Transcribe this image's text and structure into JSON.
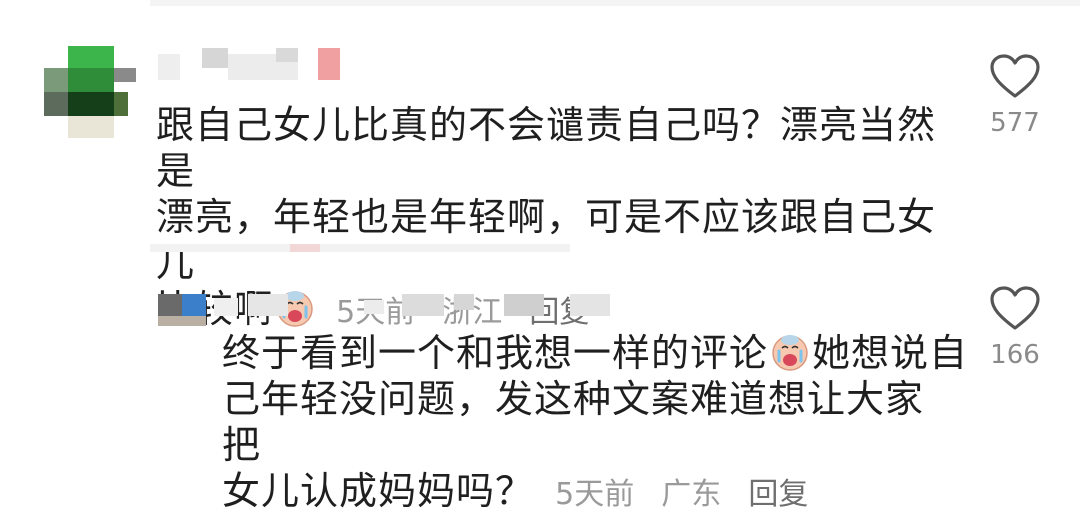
{
  "comments": [
    {
      "text_line1": "跟自己女儿比真的不会谴责自己吗？漂亮当然是",
      "text_line2": "漂亮，年轻也是年轻啊，可是不应该跟自己女儿",
      "text_line3": "比较啊",
      "emoji": "crying-face-icon",
      "time": "5天前",
      "location": "浙江",
      "reply": "回复",
      "likes": "577"
    },
    {
      "text_line1": "终于看到一个和我想一样的评论",
      "text_line1b": "她想说自",
      "text_line2": "己年轻没问题，发这种文案难道想让大家把",
      "text_line3": "女儿认成妈妈吗？",
      "emoji": "crying-face-icon",
      "time": "5天前",
      "location": "广东",
      "reply": "回复",
      "likes": "166"
    }
  ],
  "colors": {
    "text": "#1f1f1f",
    "meta": "#9a9a9a",
    "heart_stroke": "#555555"
  }
}
